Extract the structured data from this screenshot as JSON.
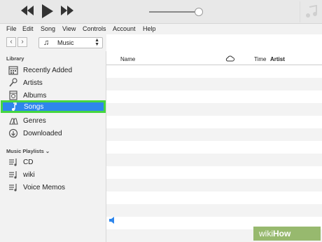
{
  "menu": [
    "File",
    "Edit",
    "Song",
    "View",
    "Controls",
    "Account",
    "Help"
  ],
  "player": {
    "volume_level": 0.93
  },
  "library_selector": {
    "label": "Music"
  },
  "sidebar": {
    "library_title": "Library",
    "library_items": [
      {
        "label": "Recently Added",
        "icon": "recently-added-icon"
      },
      {
        "label": "Artists",
        "icon": "artists-icon"
      },
      {
        "label": "Albums",
        "icon": "albums-icon"
      },
      {
        "label": "Songs",
        "icon": "songs-icon",
        "selected": true
      },
      {
        "label": "Genres",
        "icon": "genres-icon"
      },
      {
        "label": "Downloaded",
        "icon": "downloaded-icon"
      }
    ],
    "playlists_title": "Music Playlists ⌄",
    "playlists": [
      {
        "label": "CD"
      },
      {
        "label": "wiki"
      },
      {
        "label": "Voice Memos"
      }
    ]
  },
  "columns": {
    "name": "Name",
    "time": "Time",
    "artist": "Artist"
  },
  "accent": {
    "selection_blue": "#2e86ec",
    "highlight_green": "#46d640"
  },
  "watermark": {
    "prefix": "wiki",
    "suffix": "How"
  }
}
